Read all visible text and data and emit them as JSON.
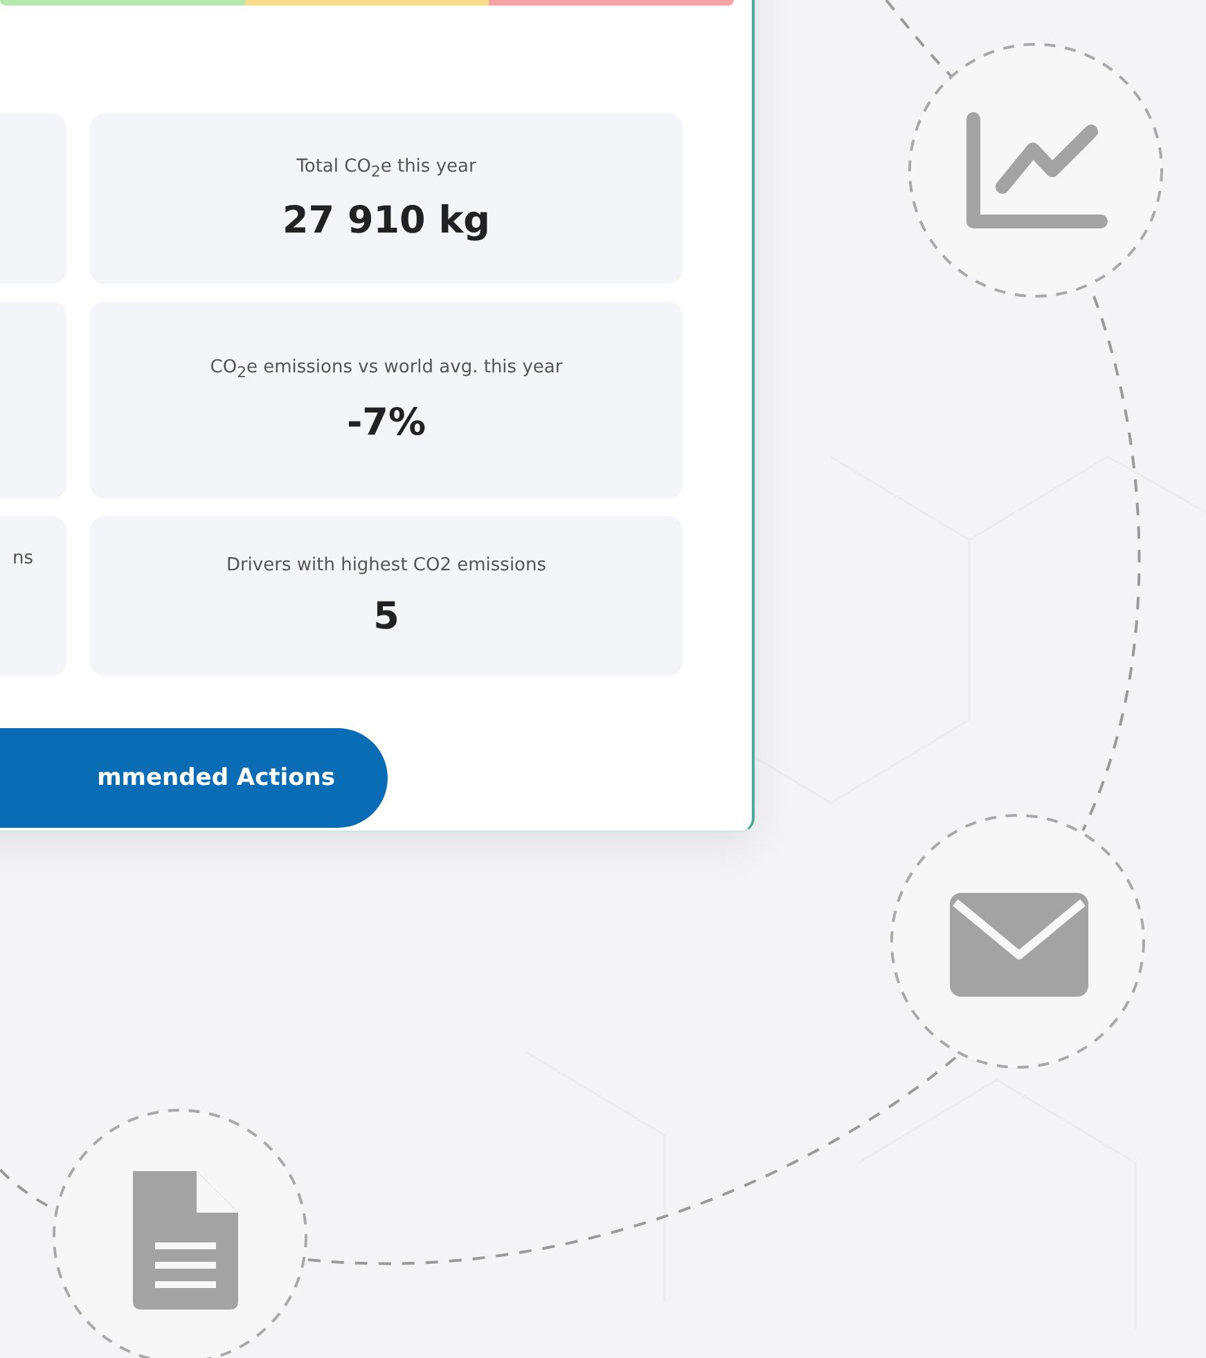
{
  "rating_bar": {
    "segments": [
      {
        "color": "#b5e8ad"
      },
      {
        "color": "#f8dc8c"
      },
      {
        "color": "#f5a3a3"
      }
    ]
  },
  "stats": {
    "left_column": [
      {
        "label": "ns"
      }
    ],
    "right_column": [
      {
        "label": "Total CO$_{2}$e this year",
        "value": "27 910 kg"
      },
      {
        "label": "CO$_{2}$e emissions vs world avg. this year",
        "value": "-7%"
      },
      {
        "label": "Drivers with highest CO2 emissions",
        "value": "5"
      }
    ]
  },
  "action_button": {
    "label": "mmended Actions"
  }
}
